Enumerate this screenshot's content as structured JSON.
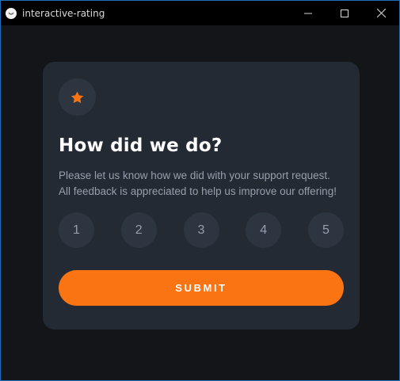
{
  "window": {
    "title": "interactive-rating"
  },
  "card": {
    "icon": "star-icon",
    "heading": "How did we do?",
    "body": "Please let us know how we did with your support request. All feedback is appreciated to help us improve our offering!",
    "ratings": [
      "1",
      "2",
      "3",
      "4",
      "5"
    ],
    "submit_label": "SUBMIT"
  },
  "colors": {
    "accent": "#fb7413",
    "card_bg": "#232a33",
    "page_bg": "#131518",
    "circle_bg": "#2d3540",
    "muted_text": "#969fad"
  }
}
